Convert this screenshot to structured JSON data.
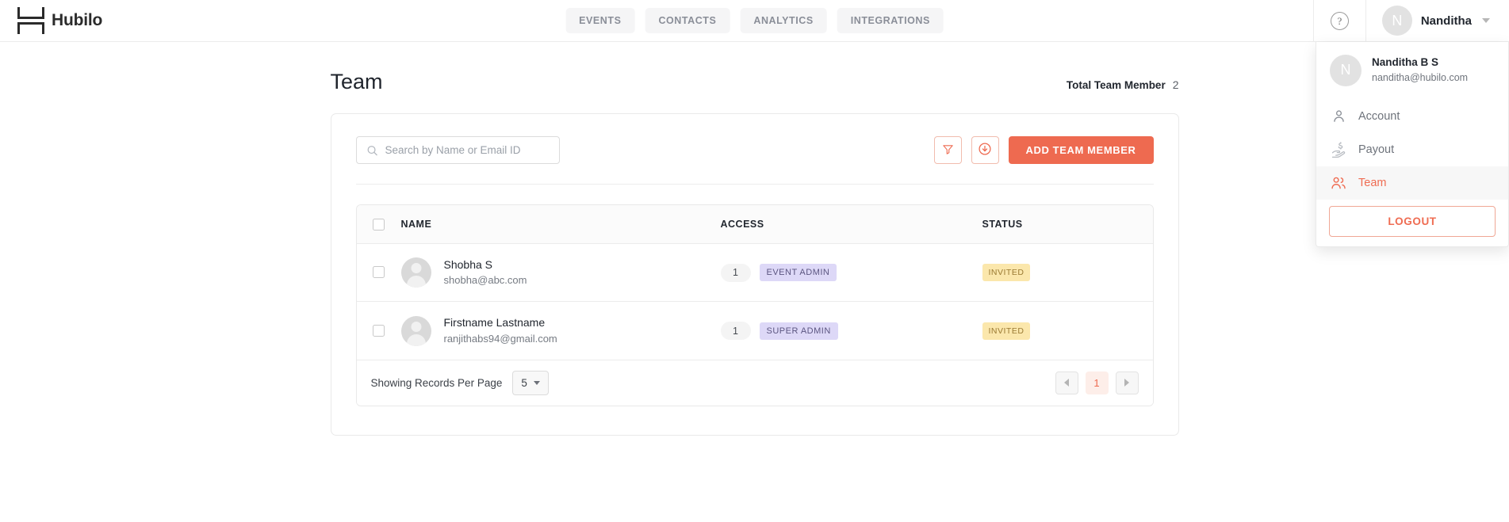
{
  "brand": {
    "name": "Hubilo",
    "logo_icon": "hubilo-h-logo"
  },
  "nav": {
    "tabs": [
      {
        "label": "EVENTS"
      },
      {
        "label": "CONTACTS"
      },
      {
        "label": "ANALYTICS"
      },
      {
        "label": "INTEGRATIONS"
      }
    ]
  },
  "header": {
    "help_icon": "question-mark-circle-icon",
    "help_glyph": "?",
    "user": {
      "avatar_initial": "N",
      "name": "Nanditha",
      "caret_icon": "chevron-down-icon"
    }
  },
  "user_menu": {
    "profile": {
      "avatar_initial": "N",
      "name": "Nanditha B S",
      "email": "nanditha@hubilo.com"
    },
    "items": [
      {
        "label": "Account",
        "icon": "person-icon",
        "active": false
      },
      {
        "label": "Payout",
        "icon": "hand-dollar-icon",
        "active": false
      },
      {
        "label": "Team",
        "icon": "people-group-icon",
        "active": true
      }
    ],
    "logout_label": "LOGOUT"
  },
  "page": {
    "title": "Team",
    "total_label": "Total Team Member",
    "total_value": "2"
  },
  "toolbar": {
    "search_placeholder": "Search by Name or Email ID",
    "search_value": "",
    "search_icon": "search-icon",
    "filter_icon": "filter-funnel-icon",
    "download_icon": "download-circle-icon",
    "add_label": "ADD TEAM MEMBER"
  },
  "table": {
    "headers": {
      "select_all": "select-all-checkbox",
      "name": "NAME",
      "access": "ACCESS",
      "status": "STATUS"
    },
    "rows": [
      {
        "name": "Shobha S",
        "email": "shobha@abc.com",
        "access_count": "1",
        "role": "EVENT ADMIN",
        "status": "INVITED"
      },
      {
        "name": "Firstname Lastname",
        "email": "ranjithabs94@gmail.com",
        "access_count": "1",
        "role": "SUPER ADMIN",
        "status": "INVITED"
      }
    ]
  },
  "pagination": {
    "records_label": "Showing Records Per Page",
    "per_page": "5",
    "prev_icon": "chevron-left-icon",
    "next_icon": "chevron-right-icon",
    "current_page": "1"
  },
  "colors": {
    "accent": "#ee6a50",
    "role_badge_bg": "#ddd8f7",
    "status_badge_bg": "#fbe7ac",
    "page_active_bg": "#fdeee9"
  }
}
